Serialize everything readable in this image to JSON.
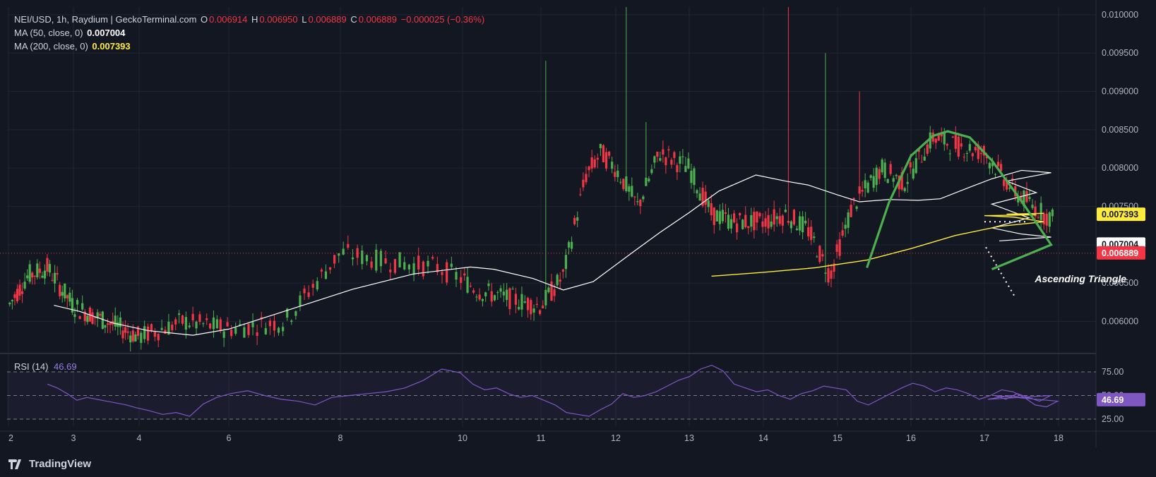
{
  "header": {
    "symbol": "NEI/USD, 1h, Raydium | GeckoTerminal.com",
    "o_label": "O",
    "o_value": "0.006914",
    "h_label": "H",
    "h_value": "0.006950",
    "l_label": "L",
    "l_value": "0.006889",
    "c_label": "C",
    "c_value": "0.006889",
    "change": "−0.000025 (−0.36%)",
    "ma50_label": "MA (50, close, 0)",
    "ma50_value": "0.007004",
    "ma200_label": "MA (200, close, 0)",
    "ma200_value": "0.007393"
  },
  "rsi": {
    "label": "RSI (14)",
    "value": "46.69"
  },
  "brand": "TradingView",
  "colors": {
    "background": "#131722",
    "up": "#26a69a",
    "up_bright": "#4caf50",
    "down": "#f23645",
    "ma50": "#ffffff",
    "ma200": "#ffeb3b",
    "rsi_line": "#7e57c2",
    "pattern": "#4caf50"
  },
  "chart_data": {
    "type": "candlestick",
    "price_axis": [
      "0.010000",
      "0.009500",
      "0.009000",
      "0.008500",
      "0.008000",
      "0.007500",
      "0.007000",
      "0.006500",
      "0.006000"
    ],
    "time_axis": [
      "2",
      "3",
      "4",
      "6",
      "8",
      "10",
      "11",
      "12",
      "13",
      "14",
      "15",
      "16",
      "17",
      "18"
    ],
    "ylim": [
      0.0056,
      0.0101
    ],
    "badges": {
      "ma200": "0.007393",
      "ma50": "0.007004",
      "last": "0.006889",
      "rsi": "46.69"
    },
    "rsi_axis": [
      "75.00",
      "50.00",
      "25.00"
    ],
    "annotation": "Ascending Triangle",
    "ma50": [
      [
        0.7,
        0.00621
      ],
      [
        1.1,
        0.00613
      ],
      [
        1.6,
        0.00598
      ],
      [
        2.1,
        0.00588
      ],
      [
        2.6,
        0.00582
      ],
      [
        3.0,
        0.0059
      ],
      [
        3.6,
        0.00618
      ],
      [
        4.1,
        0.00642
      ],
      [
        4.6,
        0.00662
      ],
      [
        5.1,
        0.00671
      ],
      [
        5.4,
        0.00668
      ],
      [
        5.9,
        0.00656
      ],
      [
        6.3,
        0.00641
      ],
      [
        6.7,
        0.00652
      ],
      [
        7.2,
        0.00688
      ],
      [
        7.6,
        0.00716
      ],
      [
        8.0,
        0.00742
      ],
      [
        8.4,
        0.0077
      ],
      [
        8.9,
        0.00791
      ],
      [
        9.3,
        0.00783
      ],
      [
        9.6,
        0.00778
      ],
      [
        10.0,
        0.00765
      ],
      [
        10.3,
        0.00756
      ],
      [
        10.7,
        0.00759
      ],
      [
        11.1,
        0.00758
      ],
      [
        11.4,
        0.0076
      ],
      [
        11.8,
        0.00775
      ],
      [
        12.1,
        0.00786
      ],
      [
        12.5,
        0.00797
      ],
      [
        12.9,
        0.00794
      ],
      [
        13.3,
        0.00783
      ],
      [
        13.7,
        0.00768
      ],
      [
        14.1,
        0.00753
      ],
      [
        14.6,
        0.00735
      ],
      [
        15.1,
        0.00722
      ],
      [
        15.5,
        0.00714
      ],
      [
        15.9,
        0.0071
      ],
      [
        16.2,
        0.00705
      ]
    ],
    "ma200": [
      [
        8.3,
        0.00659
      ],
      [
        9.0,
        0.00664
      ],
      [
        9.7,
        0.0067
      ],
      [
        10.4,
        0.0068
      ],
      [
        11.0,
        0.00695
      ],
      [
        11.6,
        0.00712
      ],
      [
        12.2,
        0.00724
      ],
      [
        12.8,
        0.0073
      ],
      [
        13.4,
        0.00736
      ],
      [
        14.0,
        0.00738
      ],
      [
        14.7,
        0.00739
      ],
      [
        15.3,
        0.0074
      ],
      [
        15.8,
        0.00741
      ]
    ],
    "pattern_arc": [
      [
        10.4,
        0.0067
      ],
      [
        10.7,
        0.00755
      ],
      [
        11.0,
        0.00816
      ],
      [
        11.3,
        0.00842
      ],
      [
        11.5,
        0.00848
      ],
      [
        11.8,
        0.0084
      ],
      [
        12.1,
        0.0081
      ],
      [
        12.5,
        0.00757
      ],
      [
        12.9,
        0.007
      ],
      [
        13.1,
        0.00668
      ]
    ],
    "resistance": [
      [
        13.0,
        0.0073
      ],
      [
        14.6,
        0.0073
      ]
    ],
    "support": [
      [
        13.4,
        0.00634
      ],
      [
        15.0,
        0.007
      ]
    ],
    "rsi_values": [
      62,
      58,
      52,
      45,
      48,
      46,
      44,
      42,
      40,
      37,
      34,
      30,
      32,
      28,
      41,
      48,
      52,
      55,
      50,
      46,
      44,
      40,
      48,
      50,
      52,
      54,
      58,
      66,
      78,
      74,
      62,
      56,
      58,
      52,
      48,
      50,
      45,
      40,
      32,
      30,
      28,
      35,
      41,
      52,
      48,
      50,
      54,
      60,
      66,
      70,
      78,
      82,
      76,
      62,
      58,
      54,
      56,
      50,
      46,
      52,
      55,
      60,
      58,
      56,
      44,
      40,
      46,
      52,
      58,
      63,
      60,
      54,
      58,
      56,
      52,
      46,
      50,
      56,
      54,
      48,
      40,
      38,
      44,
      50,
      46,
      52,
      48,
      44,
      50,
      46,
      48,
      50,
      48,
      47
    ]
  }
}
